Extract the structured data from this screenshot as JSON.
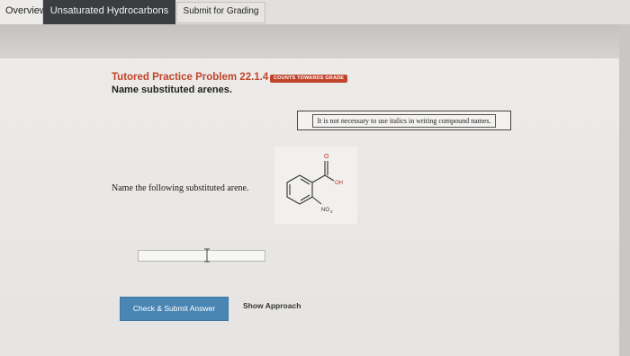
{
  "tabs": {
    "overview": "Overview",
    "active": "Unsaturated Hydrocarbons",
    "submit": "Submit for Grading"
  },
  "problem": {
    "title": "Tutored Practice Problem 22.1.4",
    "badge": "COUNTS TOWARDS GRADE",
    "subtitle": "Name substituted arenes."
  },
  "note": "It is not necessary to use italics in writing compound names.",
  "question": "Name the following substituted arene.",
  "molecule": {
    "o_label": "O",
    "oh_label": "OH",
    "no2_label": "NO",
    "no2_sub": "2"
  },
  "answer": {
    "value": ""
  },
  "buttons": {
    "check_submit": "Check & Submit Answer",
    "show_approach": "Show Approach"
  },
  "colors": {
    "accent": "#c1442a",
    "tab_active_bg": "#3b3d40",
    "button_blue": "#4a86b4"
  }
}
